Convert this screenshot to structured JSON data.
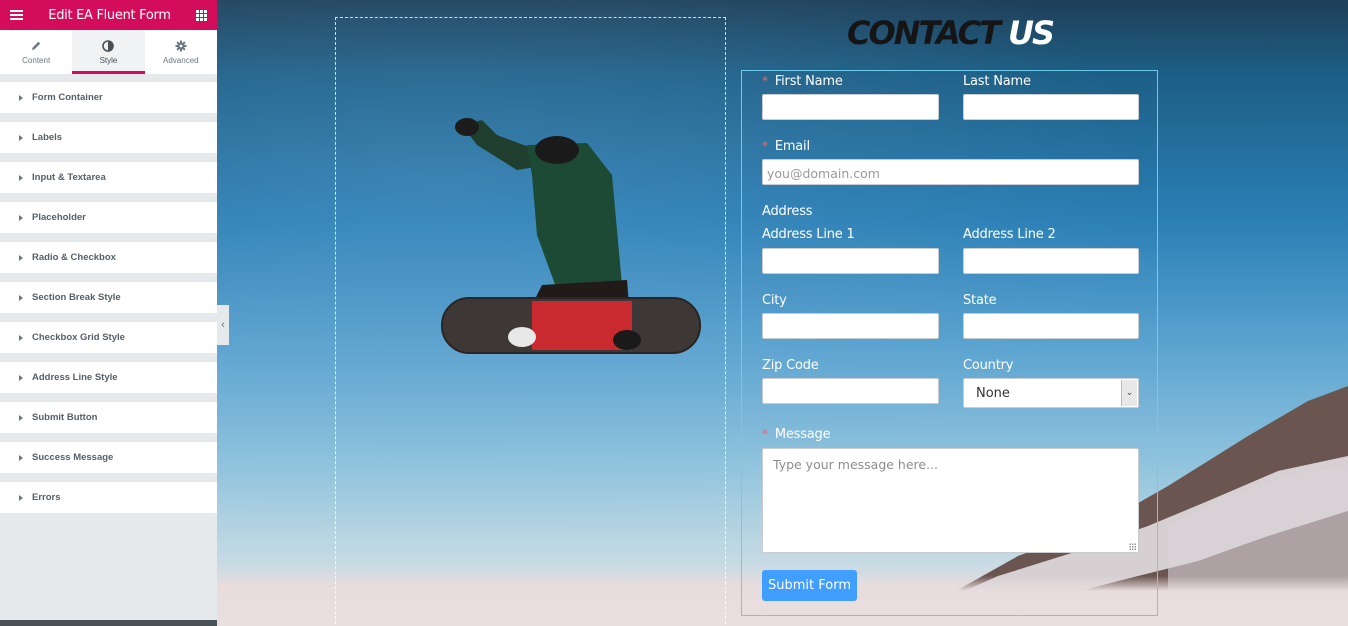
{
  "panel": {
    "title": "Edit EA Fluent Form",
    "tabs": [
      {
        "label": "Content",
        "icon": "pencil-icon",
        "active": false
      },
      {
        "label": "Style",
        "icon": "half-circle-icon",
        "active": true
      },
      {
        "label": "Advanced",
        "icon": "gear-icon",
        "active": false
      }
    ],
    "sections": [
      "Form Container",
      "Labels",
      "Input & Textarea",
      "Placeholder",
      "Radio & Checkbox",
      "Section Break Style",
      "Checkbox Grid Style",
      "Address Line Style",
      "Submit Button",
      "Success Message",
      "Errors"
    ],
    "accent_color": "#d30c5c"
  },
  "preview": {
    "heading": {
      "part1": "CONTACT",
      "part2": "US"
    },
    "form": {
      "required_marker": "*",
      "first_name": {
        "label": "First Name",
        "value": ""
      },
      "last_name": {
        "label": "Last Name",
        "value": ""
      },
      "email": {
        "label": "Email",
        "placeholder": "you@domain.com"
      },
      "address": {
        "label": "Address"
      },
      "address_line_1": {
        "label": "Address Line 1",
        "value": ""
      },
      "address_line_2": {
        "label": "Address Line 2",
        "value": ""
      },
      "city": {
        "label": "City",
        "value": ""
      },
      "state": {
        "label": "State",
        "value": ""
      },
      "zip": {
        "label": "Zip Code",
        "value": ""
      },
      "country": {
        "label": "Country",
        "selected": "None"
      },
      "message": {
        "label": "Message",
        "placeholder": "Type your message here..."
      },
      "submit_label": "Submit Form",
      "submit_color": "#409eff"
    }
  }
}
